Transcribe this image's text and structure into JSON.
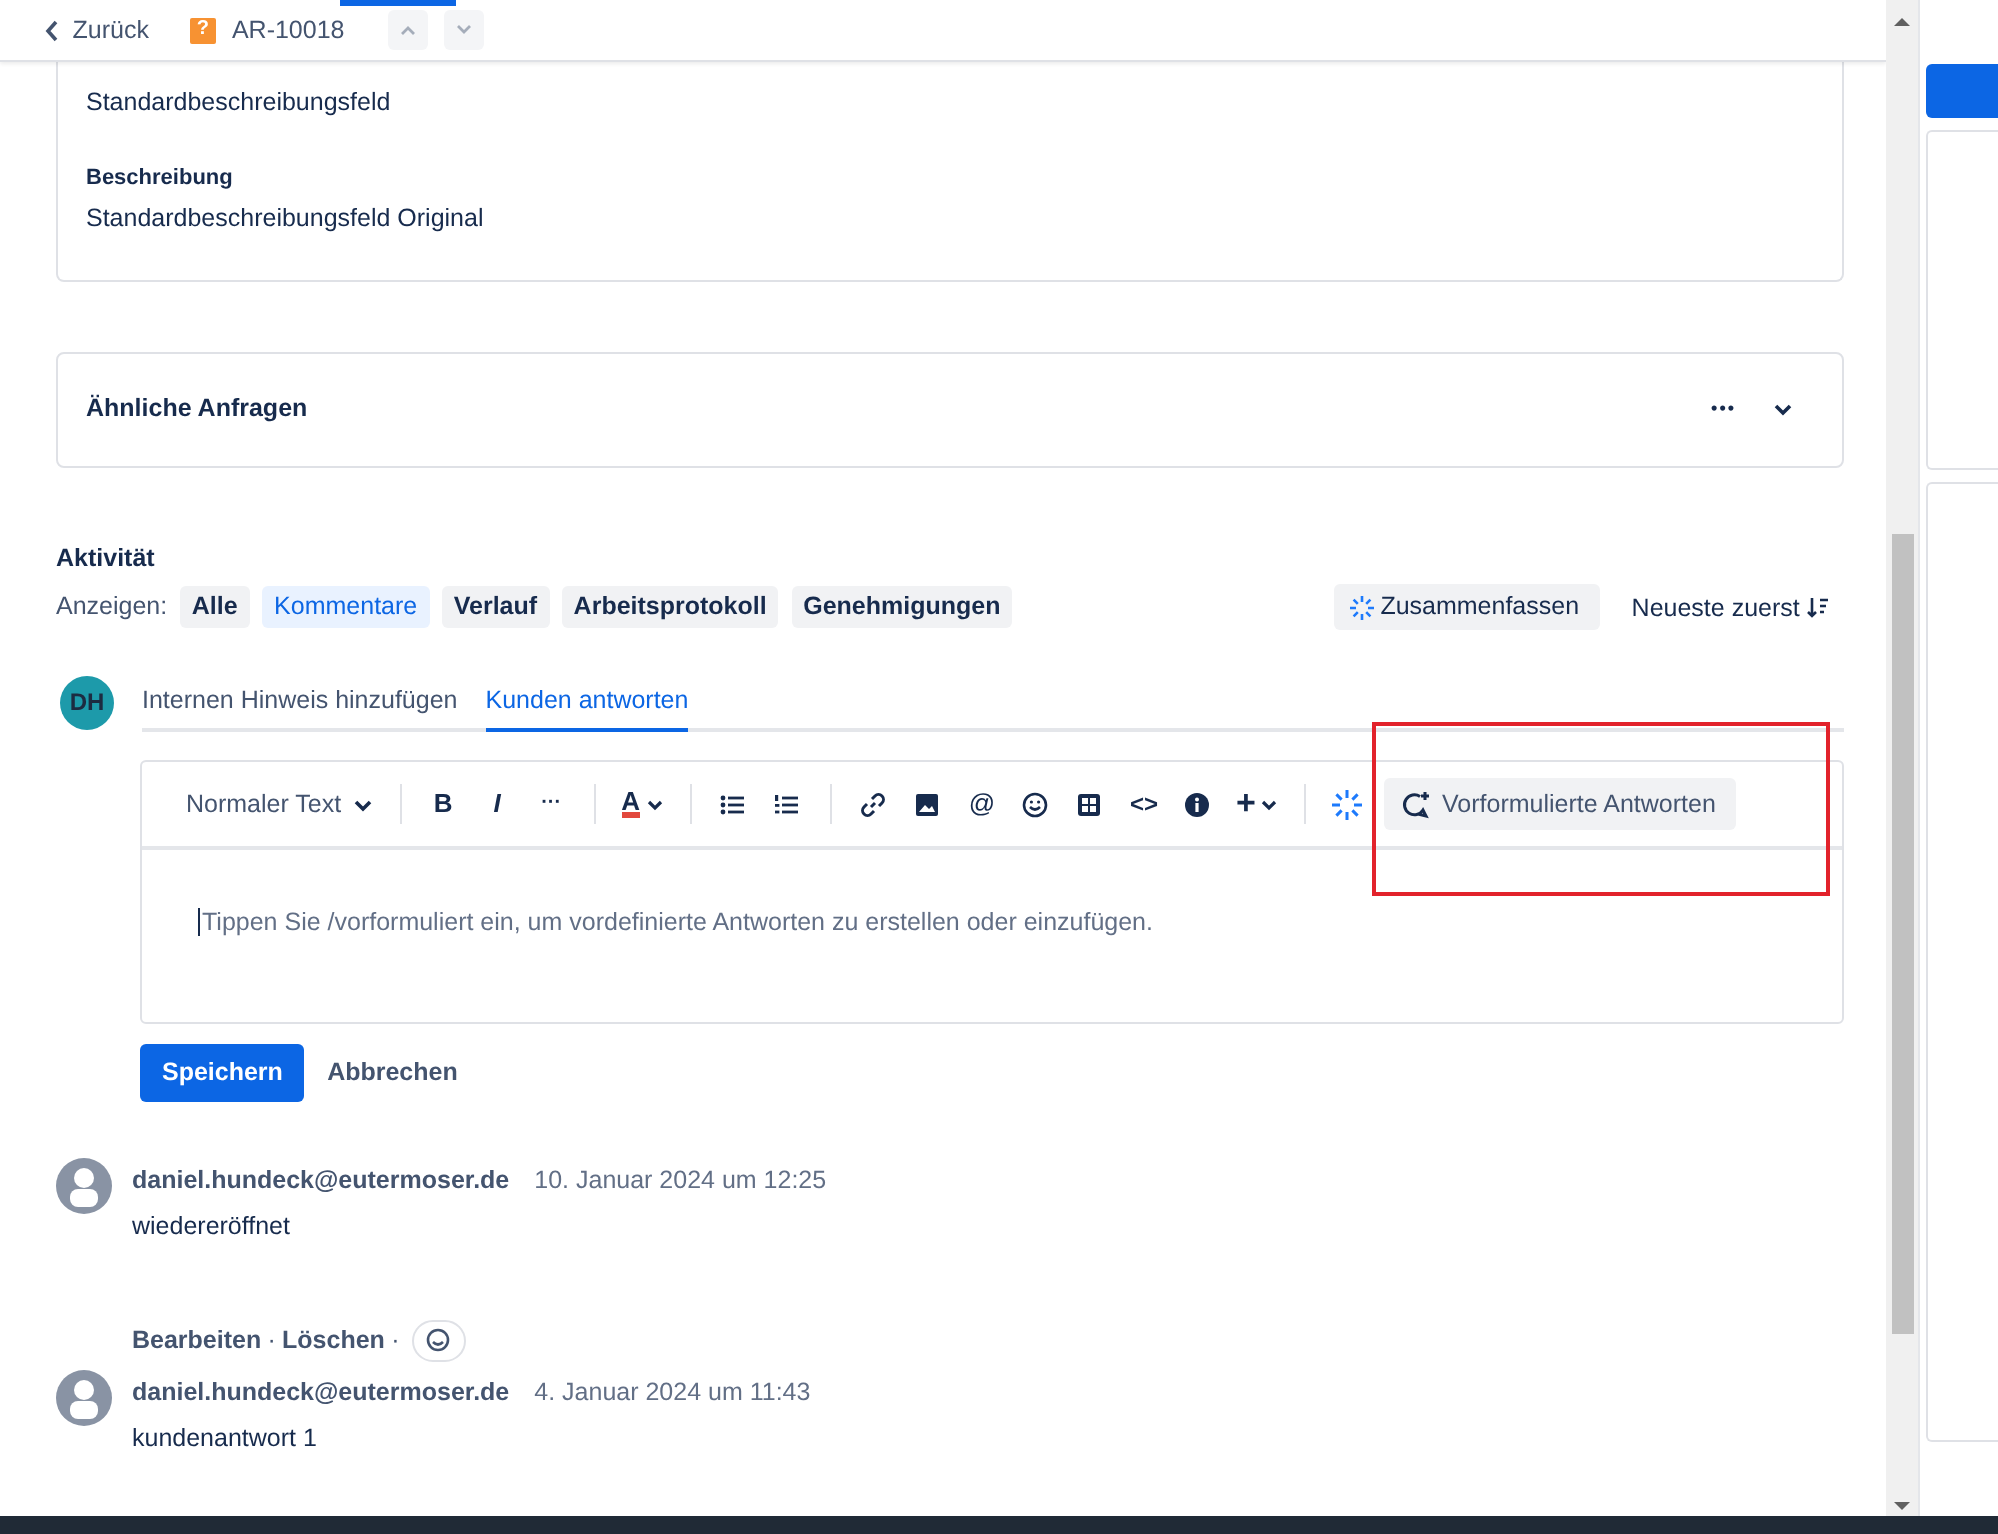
{
  "header": {
    "back_label": "Zurück",
    "issue_type_glyph": "?",
    "issue_key": "AR-10018"
  },
  "description_card": {
    "fields": [
      {
        "value": "Standardbeschreibungsfeld"
      },
      {
        "label": "Beschreibung",
        "value": "Standardbeschreibungsfeld Original"
      }
    ]
  },
  "similar_requests": {
    "title": "Ähnliche Anfragen",
    "more_glyph": "•••"
  },
  "activity": {
    "title": "Aktivität",
    "filter_label": "Anzeigen:",
    "filters": [
      {
        "label": "Alle",
        "selected": false
      },
      {
        "label": "Kommentare",
        "selected": true
      },
      {
        "label": "Verlauf",
        "selected": false
      },
      {
        "label": "Arbeitsprotokoll",
        "selected": false
      },
      {
        "label": "Genehmigungen",
        "selected": false
      }
    ],
    "summarize": "Zusammenfassen",
    "sort": "Neueste zuerst"
  },
  "composer": {
    "avatar": "DH",
    "tabs": [
      {
        "label": "Internen Hinweis hinzufügen",
        "selected": false
      },
      {
        "label": "Kunden antworten",
        "selected": true
      }
    ],
    "toolbar": {
      "text_style": "Normaler Text",
      "bold": "B",
      "italic": "I",
      "more": "···",
      "text_color": "A",
      "mention": "@",
      "code": "<>",
      "insert": "+",
      "canned_responses": "Vorformulierte Antworten"
    },
    "placeholder": "Tippen Sie /vorformuliert ein, um vordefinierte Antworten zu erstellen oder einzufügen.",
    "save": "Speichern",
    "cancel": "Abbrechen"
  },
  "comments": [
    {
      "author": "daniel.hundeck@eutermoser.de",
      "time": "10. Januar 2024 um 12:25",
      "body": "wiedereröffnet",
      "actions": [
        "Bearbeiten",
        "Löschen"
      ],
      "action_separator": "·"
    },
    {
      "author": "daniel.hundeck@eutermoser.de",
      "time": "4. Januar 2024 um 11:43",
      "body": "kundenantwort 1"
    }
  ]
}
